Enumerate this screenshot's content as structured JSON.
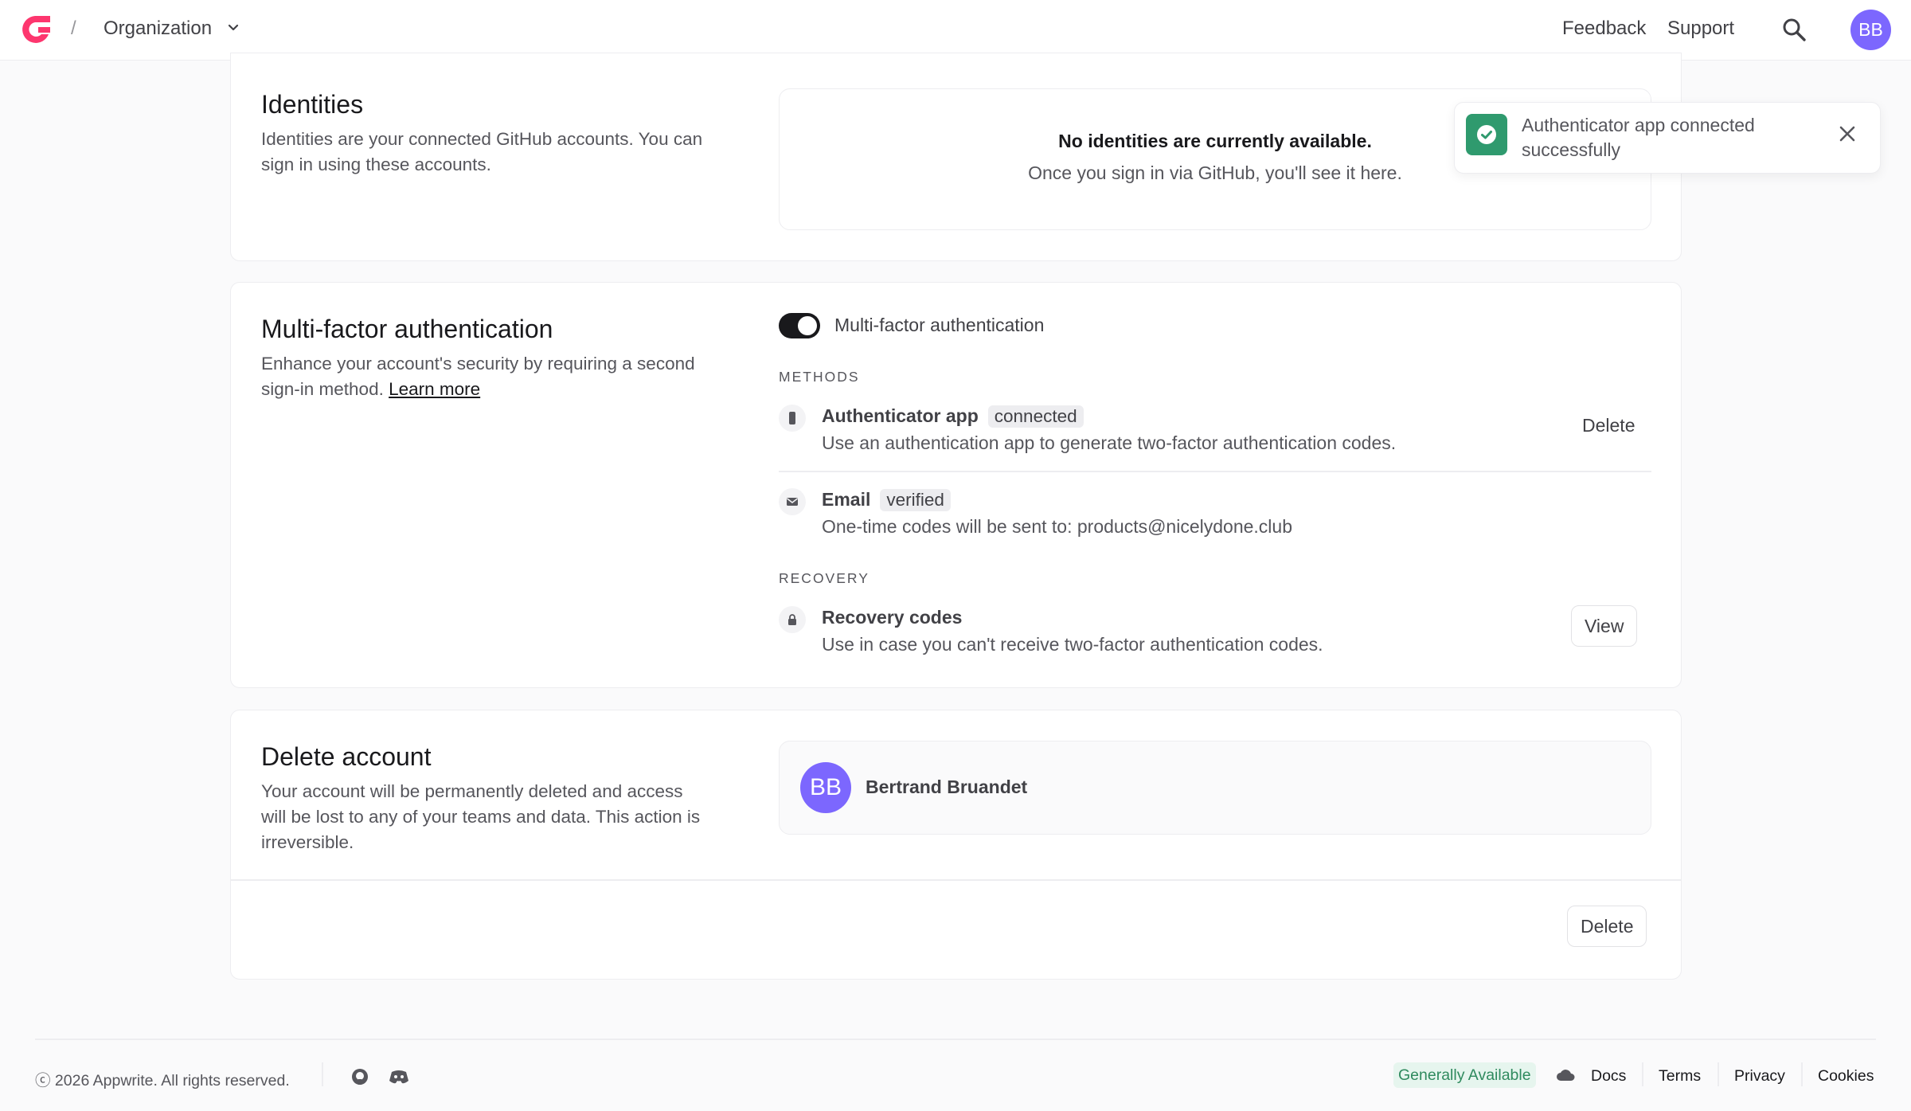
{
  "header": {
    "separator": "/",
    "org_name": "Organization",
    "feedback": "Feedback",
    "support": "Support",
    "avatar_initials": "BB"
  },
  "identities": {
    "title": "Identities",
    "description": "Identities are your connected GitHub accounts. You can sign in using these accounts.",
    "empty_title": "No identities are currently available.",
    "empty_subtitle": "Once you sign in via GitHub, you'll see it here."
  },
  "mfa": {
    "title": "Multi-factor authentication",
    "description": "Enhance your account's security by requiring a second sign-in method.",
    "learn_more": "Learn more",
    "toggle_label": "Multi-factor authentication",
    "toggle_on": true,
    "methods_label": "METHODS",
    "methods": [
      {
        "title": "Authenticator app",
        "badge": "connected",
        "description": "Use an authentication app to generate two-factor authentication codes.",
        "action": "Delete",
        "icon": "phone-icon"
      },
      {
        "title": "Email",
        "badge": "verified",
        "description": "One-time codes will be sent to: products@nicelydone.club",
        "icon": "mail-icon"
      }
    ],
    "recovery_label": "RECOVERY",
    "recovery": {
      "title": "Recovery codes",
      "description": "Use in case you can't receive two-factor authentication codes.",
      "action": "View",
      "icon": "lock-icon"
    }
  },
  "delete_account": {
    "title": "Delete account",
    "description": "Your account will be permanently deleted and access will be lost to any of your teams and data. This action is irreversible.",
    "user_initials": "BB",
    "user_name": "Bertrand Bruandet",
    "delete_label": "Delete"
  },
  "toast": {
    "message": "Authenticator app connected successfully"
  },
  "footer": {
    "copyright": "ⓒ 2026 Appwrite. All rights reserved.",
    "status_badge": "Generally Available",
    "links": [
      "Docs",
      "Terms",
      "Privacy",
      "Cookies"
    ]
  },
  "colors": {
    "brand": "#fd366e",
    "avatar": "#7c67fe",
    "success": "#2f9a6e"
  }
}
